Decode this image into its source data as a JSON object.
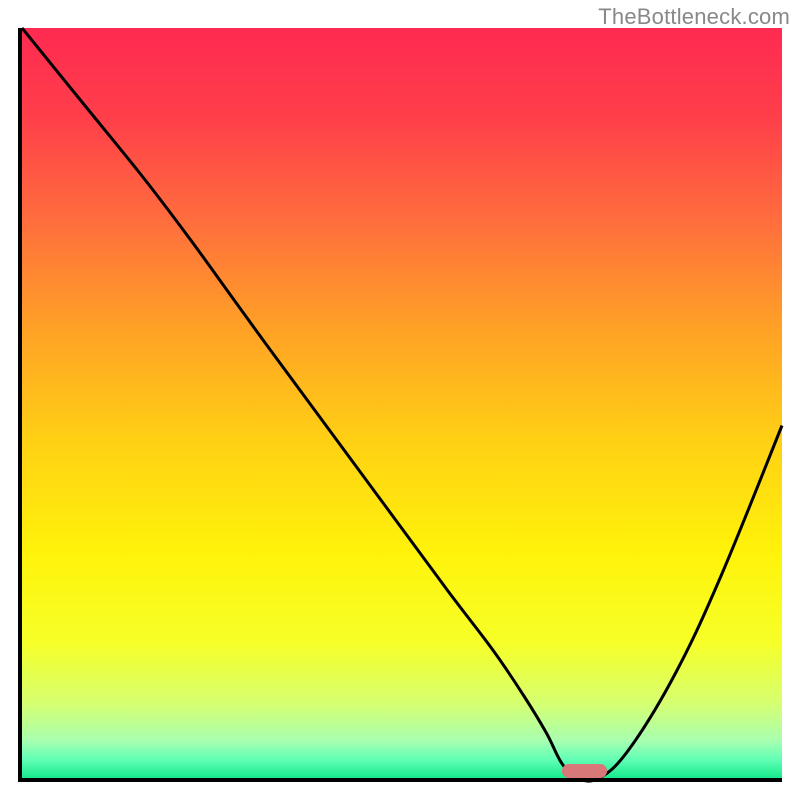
{
  "watermark": "TheBottleneck.com",
  "chart_data": {
    "type": "line",
    "title": "",
    "xlabel": "",
    "ylabel": "",
    "xlim": [
      0,
      100
    ],
    "ylim": [
      0,
      100
    ],
    "grid": false,
    "background_gradient": {
      "stops": [
        {
          "offset": 0.0,
          "color": "#ff2a51"
        },
        {
          "offset": 0.12,
          "color": "#ff3f4a"
        },
        {
          "offset": 0.25,
          "color": "#ff6b3e"
        },
        {
          "offset": 0.4,
          "color": "#ffa126"
        },
        {
          "offset": 0.55,
          "color": "#ffd014"
        },
        {
          "offset": 0.7,
          "color": "#fff30a"
        },
        {
          "offset": 0.82,
          "color": "#f6ff28"
        },
        {
          "offset": 0.9,
          "color": "#d6ff70"
        },
        {
          "offset": 0.95,
          "color": "#a8ffb0"
        },
        {
          "offset": 0.975,
          "color": "#62ffb5"
        },
        {
          "offset": 1.0,
          "color": "#17ea8c"
        }
      ]
    },
    "series": [
      {
        "name": "bottleneck-curve",
        "color": "#000000",
        "x": [
          0,
          8,
          16,
          22,
          27,
          32,
          40,
          48,
          56,
          62,
          66,
          69,
          71,
          73,
          76,
          80,
          86,
          92,
          100
        ],
        "y": [
          100,
          90,
          80,
          72,
          65,
          58,
          47,
          36,
          25,
          17,
          11,
          6,
          2,
          0,
          0,
          4,
          14,
          27,
          47
        ]
      }
    ],
    "marker": {
      "name": "target-range",
      "color": "#d87879",
      "x_start": 71,
      "x_end": 77,
      "y": 1
    }
  }
}
